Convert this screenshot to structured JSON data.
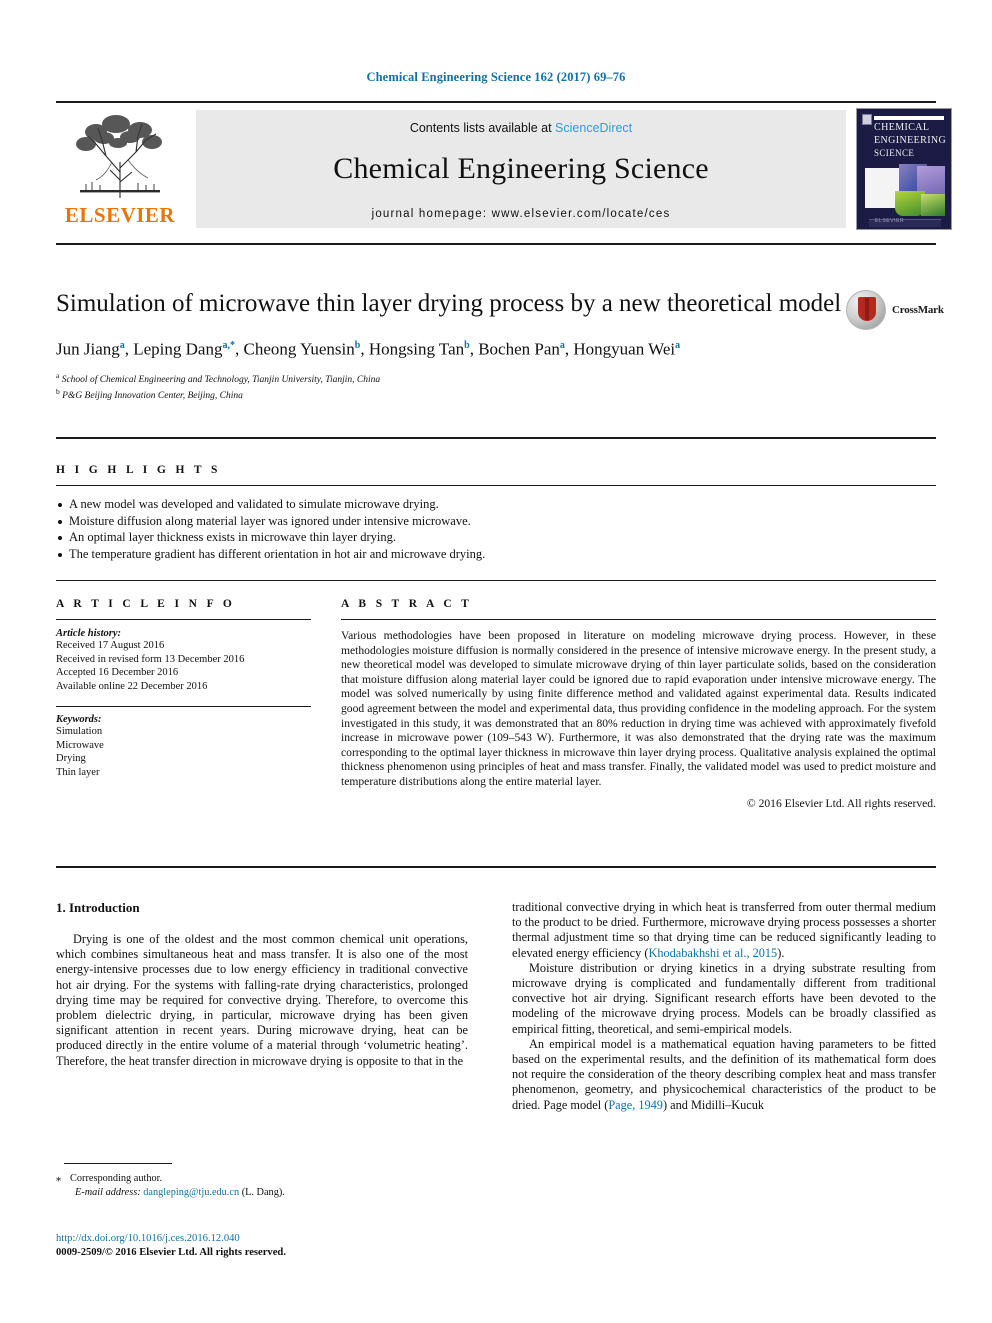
{
  "running_head": "Chemical Engineering Science 162 (2017) 69–76",
  "masthead": {
    "publisher_name": "ELSEVIER",
    "contents_prefix": "Contents lists available at ",
    "contents_link": "ScienceDirect",
    "journal_title": "Chemical Engineering Science",
    "homepage": "journal homepage: www.elsevier.com/locate/ces",
    "cover": {
      "line1": "CHEMICAL",
      "line2": "ENGINEERING",
      "line3": "SCIENCE",
      "footer": "ELSEVIER"
    }
  },
  "article": {
    "title": "Simulation of microwave thin layer drying process by a new theoretical model",
    "crossmark_label": "CrossMark",
    "authors": [
      {
        "name": "Jun Jiang",
        "marks": "a"
      },
      {
        "name": "Leping Dang",
        "marks": "a,*"
      },
      {
        "name": "Cheong Yuensin",
        "marks": "b"
      },
      {
        "name": "Hongsing Tan",
        "marks": "b"
      },
      {
        "name": "Bochen Pan",
        "marks": "a"
      },
      {
        "name": "Hongyuan Wei",
        "marks": "a"
      }
    ],
    "affiliations": [
      {
        "mark": "a",
        "text": "School of Chemical Engineering and Technology, Tianjin University, Tianjin, China"
      },
      {
        "mark": "b",
        "text": "P&G Beijing Innovation Center, Beijing, China"
      }
    ]
  },
  "highlights": {
    "heading": "H I G H L I G H T S",
    "items": [
      "A new model was developed and validated to simulate microwave drying.",
      "Moisture diffusion along material layer was ignored under intensive microwave.",
      "An optimal layer thickness exists in microwave thin layer drying.",
      "The temperature gradient has different orientation in hot air and microwave drying."
    ]
  },
  "article_info": {
    "heading": "A R T I C L E   I N F O",
    "history_label": "Article history:",
    "history": [
      "Received 17 August 2016",
      "Received in revised form 13 December 2016",
      "Accepted 16 December 2016",
      "Available online 22 December 2016"
    ],
    "keywords_label": "Keywords:",
    "keywords": [
      "Simulation",
      "Microwave",
      "Drying",
      "Thin layer"
    ]
  },
  "abstract": {
    "heading": "A B S T R A C T",
    "text": "Various methodologies have been proposed in literature on modeling microwave drying process. However, in these methodologies moisture diffusion is normally considered in the presence of intensive microwave energy. In the present study, a new theoretical model was developed to simulate microwave drying of thin layer particulate solids, based on the consideration that moisture diffusion along material layer could be ignored due to rapid evaporation under intensive microwave energy. The model was solved numerically by using finite difference method and validated against experimental data. Results indicated good agreement between the model and experimental data, thus providing confidence in the modeling approach. For the system investigated in this study, it was demonstrated that an 80% reduction in drying time was achieved with approximately fivefold increase in microwave power (109–543 W). Furthermore, it was also demonstrated that the drying rate was the maximum corresponding to the optimal layer thickness in microwave thin layer drying process. Qualitative analysis explained the optimal thickness phenomenon using principles of heat and mass transfer. Finally, the validated model was used to predict moisture and temperature distributions along the entire material layer.",
    "copyright": "© 2016 Elsevier Ltd. All rights reserved."
  },
  "body": {
    "section_heading": "1. Introduction",
    "left_paragraphs": [
      "Drying is one of the oldest and the most common chemical unit operations, which combines simultaneous heat and mass transfer. It is also one of the most energy-intensive processes due to low energy efficiency in traditional convective hot air drying. For the systems with falling-rate drying characteristics, prolonged drying time may be required for convective drying. Therefore, to overcome this problem dielectric drying, in particular, microwave drying has been given significant attention in recent years. During microwave drying, heat can be produced directly in the entire volume of a material through ‘volumetric heating’. Therefore, the heat transfer direction in microwave drying is opposite to that in the"
    ],
    "right_paragraphs": [
      {
        "pre": "traditional convective drying in which heat is transferred from outer thermal medium to the product to be dried. Furthermore, microwave drying process possesses a shorter thermal adjustment time so that drying time can be reduced significantly leading to elevated energy efficiency (",
        "cite": "Khodabakhshi et al., 2015",
        "post": ").",
        "indent": false
      },
      {
        "pre": "Moisture distribution or drying kinetics in a drying substrate resulting from microwave drying is complicated and fundamentally different from traditional convective hot air drying. Significant research efforts have been devoted to the modeling of the microwave drying process. Models can be broadly classified as empirical fitting, theoretical, and semi-empirical models.",
        "cite": "",
        "post": "",
        "indent": true
      },
      {
        "pre": "An empirical model is a mathematical equation having parameters to be fitted based on the experimental results, and the definition of its mathematical form does not require the consideration of the theory describing complex heat and mass transfer phenomenon, geometry, and physicochemical characteristics of the product to be dried. Page model (",
        "cite": "Page, 1949",
        "post": ") and Midilli–Kucuk",
        "indent": true
      }
    ]
  },
  "footer": {
    "corresponding_star": "⁎",
    "corresponding_author": "Corresponding author.",
    "email_label": "E-mail address:",
    "email": "dangleping@tju.edu.cn",
    "email_owner": "(L. Dang).",
    "doi": "http://dx.doi.org/10.1016/j.ces.2016.12.040",
    "issn": "0009-2509/© 2016 Elsevier Ltd. All rights reserved."
  },
  "colors": {
    "link": "#1170a5",
    "sciencedirect": "#2a9fd4",
    "elsevier_orange": "#ec7404",
    "band_gray": "#e9e9e9"
  }
}
